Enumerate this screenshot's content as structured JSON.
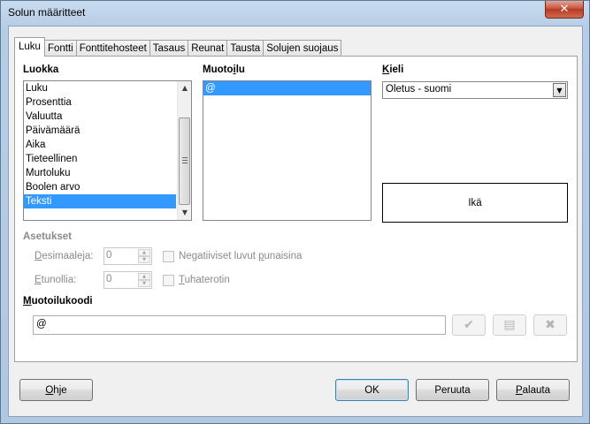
{
  "window": {
    "title": "Solun määritteet",
    "close_glyph": "✕"
  },
  "tabs": [
    {
      "label": "Luku",
      "active": true
    },
    {
      "label": "Fontti",
      "active": false
    },
    {
      "label": "Fonttitehosteet",
      "active": false
    },
    {
      "label": "Tasaus",
      "active": false
    },
    {
      "label": "Reunat",
      "active": false
    },
    {
      "label": "Tausta",
      "active": false
    },
    {
      "label": "Solujen suojaus",
      "active": false
    }
  ],
  "category": {
    "label": "Luokka",
    "items": [
      "Luku",
      "Prosenttia",
      "Valuutta",
      "Päivämäärä",
      "Aika",
      "Tieteellinen",
      "Murtoluku",
      "Boolen arvo",
      "Teksti"
    ],
    "selected": "Teksti"
  },
  "format": {
    "label_pre": "Muoto",
    "label_u": "i",
    "label_post": "lu",
    "items": [
      "@"
    ],
    "selected": "@"
  },
  "language": {
    "label_u": "K",
    "label_post": "ieli",
    "value": "Oletus - suomi"
  },
  "preview": {
    "text": "Ikä"
  },
  "options": {
    "label": "Asetukset",
    "decimals_u": "D",
    "decimals_post": "esimaaleja:",
    "decimals_value": "0",
    "leading_u": "E",
    "leading_post": "tunollia:",
    "leading_value": "0",
    "neg_red_pre": "Negatiiviset luvut ",
    "neg_red_u": "p",
    "neg_red_post": "unaisina",
    "thousands_u": "T",
    "thousands_post": "uhaterotin"
  },
  "format_code": {
    "label_u": "M",
    "label_post": "uotoilukoodi",
    "value": "@"
  },
  "buttons": {
    "help_u": "O",
    "help_post": "hje",
    "ok": "OK",
    "cancel": "Peruuta",
    "reset_u": "P",
    "reset_post": "alauta"
  }
}
